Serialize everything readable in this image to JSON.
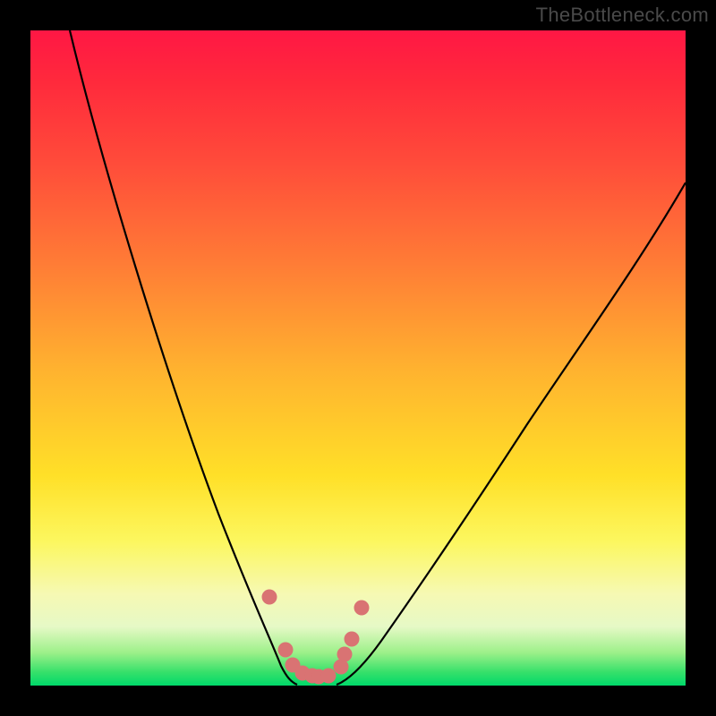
{
  "attribution": "TheBottleneck.com",
  "chart_data": {
    "type": "line",
    "title": "",
    "xlabel": "",
    "ylabel": "",
    "ylim": [
      0,
      100
    ],
    "series": [
      {
        "name": "left-curve",
        "x": [
          0.06,
          0.1,
          0.14,
          0.18,
          0.22,
          0.26,
          0.3,
          0.34,
          0.365,
          0.395
        ],
        "values": [
          100,
          92,
          80,
          66,
          50,
          34,
          20,
          10,
          5,
          0
        ]
      },
      {
        "name": "right-curve",
        "x": [
          0.47,
          0.52,
          0.57,
          0.62,
          0.68,
          0.74,
          0.8,
          0.86,
          0.92,
          1.0
        ],
        "values": [
          0,
          5,
          12,
          20,
          30,
          40,
          50,
          59,
          67,
          77
        ]
      },
      {
        "name": "marker-points",
        "x": [
          0.365,
          0.39,
          0.4,
          0.415,
          0.43,
          0.44,
          0.455,
          0.474,
          0.48,
          0.49,
          0.505
        ],
        "values": [
          13.5,
          5.5,
          3.2,
          2.0,
          1.6,
          1.5,
          1.6,
          3.0,
          4.8,
          7.2,
          12.0
        ]
      }
    ],
    "colors": {
      "curve": "#000000",
      "marker": "#d97373",
      "gradient_top": "#ff1744",
      "gradient_mid": "#ffe028",
      "gradient_bottom": "#00d96a"
    }
  }
}
